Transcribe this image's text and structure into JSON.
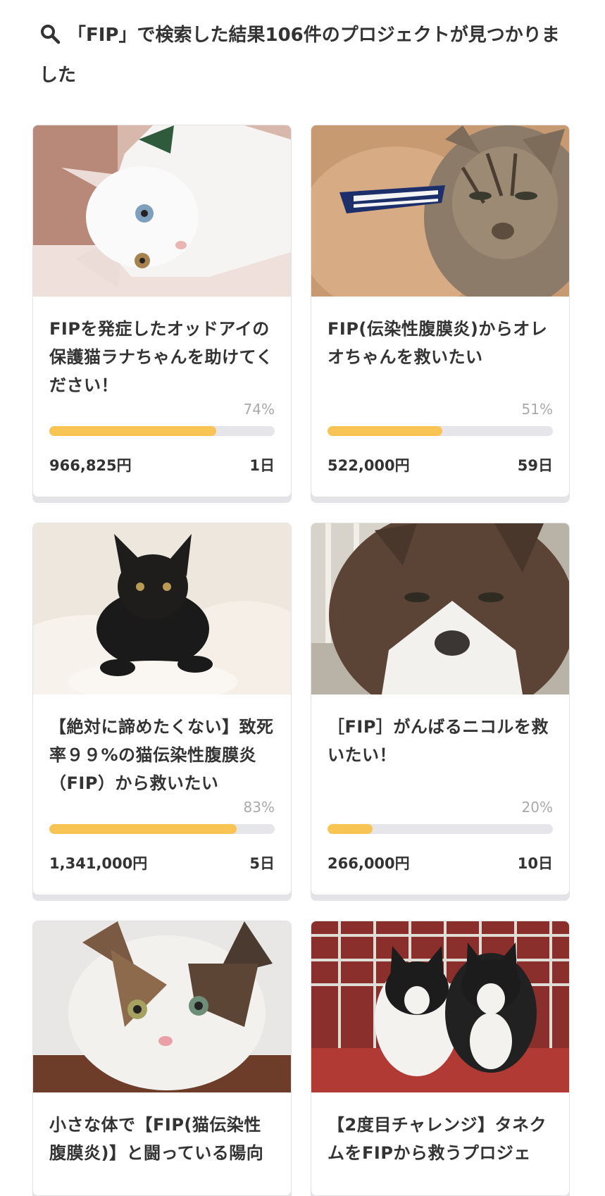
{
  "search": {
    "result_text": "「FIP」で検索した結果106件のプロジェクトが見つかりました"
  },
  "projects": [
    {
      "title": "FIPを発症したオッドアイの保護猫ラナちゃんを助けてください！",
      "percent_label": "74%",
      "progress": 0.74,
      "amount": "966,825円",
      "days_left": "1日",
      "image_icon": "white-odd-eyed-cat-photo"
    },
    {
      "title": "FIP(伝染性腹膜炎)からオレオちゃんを救いたい",
      "percent_label": "51%",
      "progress": 0.51,
      "amount": "522,000円",
      "days_left": "59日",
      "image_icon": "tabby-and-ginger-cats-photo"
    },
    {
      "title": "【絶対に諦めたくない】致死率９９%の猫伝染性腹膜炎（FIP）から救いたい",
      "percent_label": "83%",
      "progress": 0.83,
      "amount": "1,341,000円",
      "days_left": "5日",
      "image_icon": "black-kitten-photo"
    },
    {
      "title": "［FIP］がんばるニコルを救いたい！",
      "percent_label": "20%",
      "progress": 0.2,
      "amount": "266,000円",
      "days_left": "10日",
      "image_icon": "siamese-mix-cat-photo"
    },
    {
      "title": "小さな体で【FIP(猫伝染性腹膜炎)】と闘っている陽向",
      "image_icon": "calico-longhair-cat-photo"
    },
    {
      "title": "【2度目チャレンジ】タネクムをFIPから救うプロジェ",
      "image_icon": "two-tuxedo-cats-photo"
    }
  ],
  "colors": {
    "accent": "#f8c454",
    "track": "#e6e6ea",
    "text": "#333333",
    "muted": "#aaaaaa"
  }
}
